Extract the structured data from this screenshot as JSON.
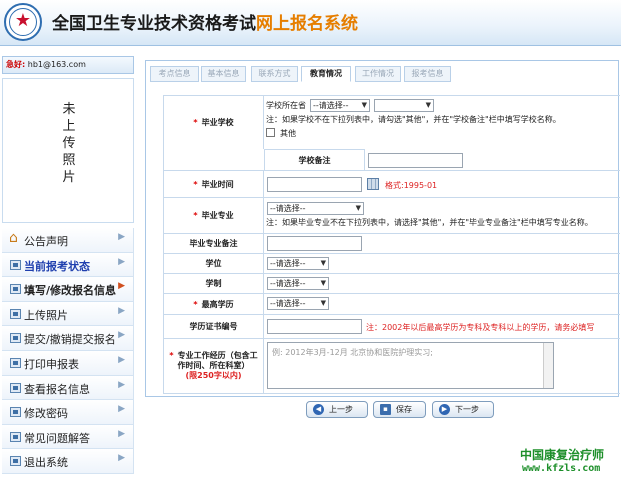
{
  "header": {
    "title_main": "全国卫生专业技术资格考试",
    "title_accent": "网上报名系统"
  },
  "sidebar": {
    "email_label": "急好:",
    "email_value": "hb1@163.com",
    "photo_text": "未上传照片",
    "items": [
      {
        "label": "公告声明"
      },
      {
        "label": "当前报考状态"
      },
      {
        "label": "填写/修改报名信息"
      },
      {
        "label": "上传照片"
      },
      {
        "label": "提交/撤销提交报名"
      },
      {
        "label": "打印申报表"
      },
      {
        "label": "查看报名信息"
      },
      {
        "label": "修改密码"
      },
      {
        "label": "常见问题解答"
      },
      {
        "label": "退出系统"
      }
    ]
  },
  "tabs": [
    {
      "label": "考点信息"
    },
    {
      "label": "基本信息"
    },
    {
      "label": "联系方式"
    },
    {
      "label": "教育情况"
    },
    {
      "label": "工作情况"
    },
    {
      "label": "报考信息"
    }
  ],
  "form": {
    "school": {
      "label": "毕业学校",
      "location_label": "学校所在省",
      "province_select": "--请选择--",
      "school_select": "",
      "note": "注：如果学校不在下拉列表中，请勾选\"其他\"，并在\"学校备注\"栏中填写学校名称。",
      "other_label": "其他",
      "remark_label": "学校备注",
      "remark_value": ""
    },
    "grad_time": {
      "label": "毕业时间",
      "value": "",
      "format_hint": "格式:1995-01"
    },
    "major": {
      "label": "毕业专业",
      "select": "--请选择--",
      "note": "注：如果毕业专业不在下拉列表中，请选择\"其他\"，并在\"毕业专业备注\"栏中填写专业名称。"
    },
    "major_remark": {
      "label": "毕业专业备注",
      "value": ""
    },
    "degree": {
      "label": "学位",
      "select": "--请选择--"
    },
    "length": {
      "label": "学制",
      "select": "--请选择--"
    },
    "education": {
      "label": "最高学历",
      "select": "--请选择--"
    },
    "cert_no": {
      "label": "学历证书编号",
      "value": "",
      "note": "注：2002年以后最高学历为专科及专科以上的学历，请务必填写"
    },
    "experience": {
      "label": "专业工作经历（包含工作时间、所在科室）",
      "limit": "(限250字以内)",
      "placeholder": "例: 2012年3月-12月 北京协和医院护理实习;"
    }
  },
  "buttons": {
    "prev": "上一步",
    "save": "保存",
    "next": "下一步"
  },
  "watermark": {
    "name": "中国康复治疗师",
    "url": "www.kfzls.com"
  },
  "colors": {
    "accent_orange": "#e67e00",
    "required_red": "#d00000",
    "brand_green": "#1d8f2a",
    "border_blue": "#a9c7e6"
  }
}
